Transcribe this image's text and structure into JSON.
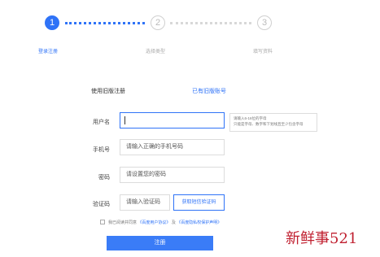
{
  "stepper": {
    "steps": [
      {
        "number": "1",
        "label": "登录注册"
      },
      {
        "number": "2",
        "label": "选择类型"
      },
      {
        "number": "3",
        "label": "填写资料"
      }
    ]
  },
  "form": {
    "title": "使用旧版注册",
    "switch_link": "已有旧版账号",
    "username": {
      "label": "用户名",
      "value": "",
      "tip_line1": "请输入6-16位的字母",
      "tip_line2": "只能是字母、数字和下划线且至少包含字母"
    },
    "phone": {
      "label": "手机号",
      "placeholder": "请输入正确的手机号码"
    },
    "password": {
      "label": "密码",
      "placeholder": "请设置您的密码"
    },
    "captcha": {
      "label": "验证码",
      "placeholder": "请输入验证码",
      "button": "获取短信验证码"
    },
    "agreement": {
      "prefix": "我已阅读并同意",
      "link1": "《百度用户协议》",
      "and": "及",
      "link2": "《百度隐私权保护声明》",
      "checked": false
    },
    "submit": "注册"
  },
  "watermark": "新鲜事521",
  "colors": {
    "accent": "#2f73f7",
    "watermark": "#c02030"
  }
}
